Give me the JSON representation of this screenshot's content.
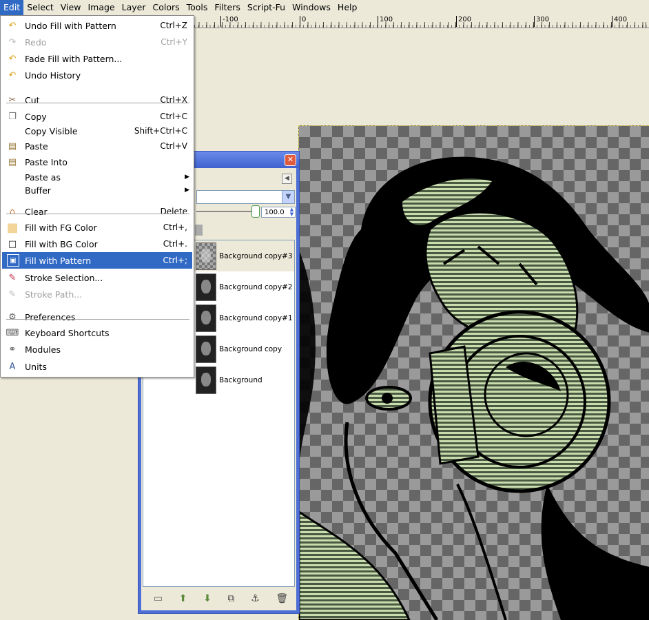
{
  "menubar": {
    "items": [
      "Edit",
      "Select",
      "View",
      "Image",
      "Layer",
      "Colors",
      "Tools",
      "Filters",
      "Script-Fu",
      "Windows",
      "Help"
    ]
  },
  "ruler": {
    "labels": [
      "-100",
      "0",
      "100",
      "200",
      "300",
      "400"
    ]
  },
  "edit_menu": {
    "items": [
      {
        "label": "Undo Fill with Pattern",
        "accel": "Ctrl+Z",
        "icon": "undo-icon",
        "enabled": true
      },
      {
        "label": "Redo",
        "accel": "Ctrl+Y",
        "icon": "redo-icon",
        "enabled": false
      },
      {
        "label": "Fade Fill with Pattern...",
        "accel": "",
        "icon": "fade-icon",
        "enabled": true
      },
      {
        "label": "Undo History",
        "accel": "",
        "icon": "undo-history-icon",
        "enabled": true
      },
      {
        "label": "Cut",
        "accel": "Ctrl+X",
        "icon": "cut-icon",
        "enabled": true
      },
      {
        "label": "Copy",
        "accel": "Ctrl+C",
        "icon": "copy-icon",
        "enabled": true
      },
      {
        "label": "Copy Visible",
        "accel": "Shift+Ctrl+C",
        "icon": "",
        "enabled": true
      },
      {
        "label": "Paste",
        "accel": "Ctrl+V",
        "icon": "paste-icon",
        "enabled": true
      },
      {
        "label": "Paste Into",
        "accel": "",
        "icon": "paste-into-icon",
        "enabled": true
      },
      {
        "label": "Paste as",
        "accel": "",
        "icon": "",
        "enabled": true,
        "submenu": true
      },
      {
        "label": "Buffer",
        "accel": "",
        "icon": "",
        "enabled": true,
        "submenu": true
      },
      {
        "label": "Clear",
        "accel": "Delete",
        "icon": "clear-icon",
        "enabled": true
      },
      {
        "label": "Fill with FG Color",
        "accel": "Ctrl+,",
        "icon": "fg-color-icon",
        "enabled": true
      },
      {
        "label": "Fill with BG Color",
        "accel": "Ctrl+.",
        "icon": "bg-color-icon",
        "enabled": true
      },
      {
        "label": "Fill with Pattern",
        "accel": "Ctrl+;",
        "icon": "pattern-icon",
        "enabled": true,
        "highlighted": true
      },
      {
        "label": "Stroke Selection...",
        "accel": "",
        "icon": "stroke-icon",
        "enabled": true
      },
      {
        "label": "Stroke Path...",
        "accel": "",
        "icon": "stroke-path-icon",
        "enabled": false
      },
      {
        "label": "Preferences",
        "accel": "",
        "icon": "preferences-icon",
        "enabled": true
      },
      {
        "label": "Keyboard Shortcuts",
        "accel": "",
        "icon": "keyboard-icon",
        "enabled": true
      },
      {
        "label": "Modules",
        "accel": "",
        "icon": "modules-icon",
        "enabled": true
      },
      {
        "label": "Units",
        "accel": "",
        "icon": "units-icon",
        "enabled": true
      }
    ]
  },
  "layers_dock": {
    "opacity_value": "100.0",
    "layers": [
      {
        "name": "Background copy#3",
        "selected": true
      },
      {
        "name": "Background copy#2",
        "selected": false
      },
      {
        "name": "Background copy#1",
        "selected": false
      },
      {
        "name": "Background copy",
        "selected": false
      },
      {
        "name": "Background",
        "selected": false
      }
    ],
    "close_symbol": "✕"
  },
  "colors": {
    "highlight": "#316ac5",
    "window_blue": "#4e6fd6",
    "pattern_green": "#c9dcae"
  }
}
